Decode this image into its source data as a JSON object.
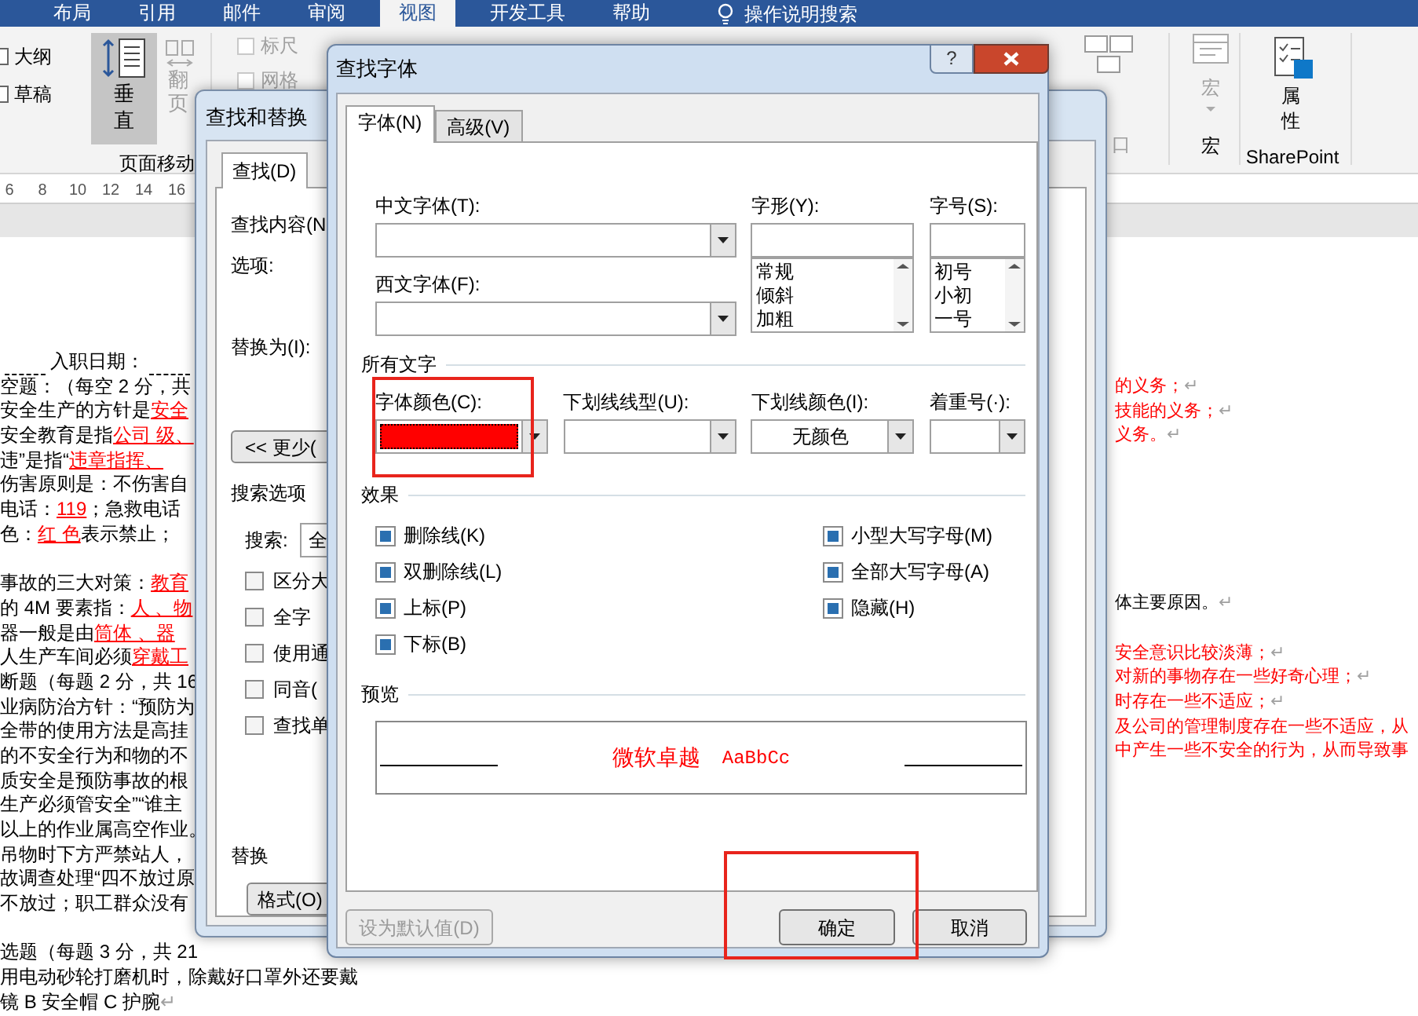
{
  "ribbon": {
    "tabs": [
      {
        "label": "布局",
        "selected": false
      },
      {
        "label": "引用",
        "selected": false
      },
      {
        "label": "邮件",
        "selected": false
      },
      {
        "label": "审阅",
        "selected": false
      },
      {
        "label": "视图",
        "selected": true
      },
      {
        "label": "开发工具",
        "selected": false
      },
      {
        "label": "帮助",
        "selected": false
      }
    ],
    "tell_me": "操作说明搜索",
    "views": [
      "大纲",
      "草稿"
    ],
    "vertical_button": {
      "label": "垂直",
      "selected": true
    },
    "page_button": {
      "label": "翻页",
      "disabled": true
    },
    "page_movement_label": "页面移动",
    "show_checks": [
      {
        "label": "标尺",
        "checked": false
      },
      {
        "label": "网格",
        "checked": false
      }
    ],
    "window_label": "口",
    "macro_button": {
      "label": "宏",
      "disabled": true
    },
    "macro_group": "宏",
    "properties_button": "属性",
    "sharepoint_group": "SharePoint"
  },
  "ruler": [
    "6",
    "8",
    "10",
    "12",
    "14",
    "16"
  ],
  "document_left": [
    [
      [
        {
          "kind": "blank"
        },
        {
          "kind": "plain",
          "text": "入职日期："
        },
        {
          "kind": "blank"
        }
      ],
      [
        {
          "kind": "plain",
          "text": "空题：（每空 2 分，共"
        }
      ],
      [
        {
          "kind": "plain",
          "text": "安全生产的方针是"
        },
        {
          "kind": "answer",
          "text": "安全"
        }
      ],
      [
        {
          "kind": "plain",
          "text": "安全教育是指"
        },
        {
          "kind": "answer",
          "text": "公司 级、"
        }
      ],
      [
        {
          "kind": "plain",
          "text": "违”是指“"
        },
        {
          "kind": "answer",
          "text": "违章指挥、"
        }
      ],
      [
        {
          "kind": "plain",
          "text": "伤害原则是：不伤害自"
        }
      ],
      [
        {
          "kind": "plain",
          "text": "电话："
        },
        {
          "kind": "answer",
          "text": "119"
        },
        {
          "kind": "plain",
          "text": "；急救电话"
        }
      ],
      [
        {
          "kind": "plain",
          "text": "色："
        },
        {
          "kind": "answer",
          "text": "红 色"
        },
        {
          "kind": "plain",
          "text": "表示禁止；"
        }
      ]
    ],
    [
      [
        {
          "kind": "plain",
          "text": "事故的三大对策："
        },
        {
          "kind": "answer",
          "text": "教育"
        }
      ],
      [
        {
          "kind": "plain",
          "text": "的 4M 要素指："
        },
        {
          "kind": "answer",
          "text": "人 、物"
        }
      ],
      [
        {
          "kind": "plain",
          "text": "器一般是由"
        },
        {
          "kind": "answer",
          "text": "筒体 、器"
        }
      ],
      [
        {
          "kind": "plain",
          "text": "人生产车间必须"
        },
        {
          "kind": "answer",
          "text": "穿戴工"
        }
      ],
      [
        {
          "kind": "plain",
          "text": "断题（每题 2 分，共 16"
        }
      ],
      [
        {
          "kind": "plain",
          "text": "业病防治方针：“预防为"
        }
      ],
      [
        {
          "kind": "plain",
          "text": "全带的使用方法是高挂"
        }
      ],
      [
        {
          "kind": "plain",
          "text": "的不安全行为和物的不"
        }
      ],
      [
        {
          "kind": "plain",
          "text": "质安全是预防事故的根"
        }
      ],
      [
        {
          "kind": "plain",
          "text": "生产必须管安全”“谁主"
        }
      ],
      [
        {
          "kind": "plain",
          "text": "以上的作业属高空作业。"
        }
      ],
      [
        {
          "kind": "plain",
          "text": "吊物时下方严禁站人，"
        }
      ],
      [
        {
          "kind": "plain",
          "text": "故调查处理“四不放过原"
        }
      ],
      [
        {
          "kind": "plain",
          "text": "不放过；职工群众没有"
        }
      ]
    ],
    [
      [
        {
          "kind": "plain",
          "text": "选题（每题 3 分，共 21"
        }
      ],
      [
        {
          "kind": "plain",
          "text": "用电动砂轮打磨机时，除戴好口罩外还要戴"
        }
      ],
      [
        {
          "kind": "plain",
          "text": "镜 B 安全帽 C 护腕"
        },
        {
          "kind": "mark",
          "text": "↵"
        }
      ]
    ]
  ],
  "document_right": [
    [
      [
        {
          "kind": "answer_text",
          "text": "的义务；"
        },
        {
          "kind": "mark",
          "text": "↵"
        }
      ],
      [
        {
          "kind": "answer_text",
          "text": "技能的义务；"
        },
        {
          "kind": "mark",
          "text": "↵"
        }
      ],
      [
        {
          "kind": "answer_text",
          "text": "义务。"
        },
        {
          "kind": "mark",
          "text": "↵"
        }
      ]
    ],
    [
      [
        {
          "kind": "plain",
          "text": "体主要原因。"
        },
        {
          "kind": "mark",
          "text": "↵"
        }
      ]
    ],
    [
      [
        {
          "kind": "answer_text",
          "text": "安全意识比较淡薄；"
        },
        {
          "kind": "mark",
          "text": "↵"
        }
      ],
      [
        {
          "kind": "answer_text",
          "text": "对新的事物存在一些好奇心理；"
        },
        {
          "kind": "mark",
          "text": "↵"
        }
      ],
      [
        {
          "kind": "answer_text",
          "text": "时存在一些不适应；"
        },
        {
          "kind": "mark",
          "text": "↵"
        }
      ],
      [
        {
          "kind": "answer_text",
          "text": "及公司的管理制度存在一些不适应，从"
        }
      ],
      [
        {
          "kind": "answer_text",
          "text": "中产生一些不安全的行为，从而导致事"
        }
      ]
    ]
  ],
  "find_replace": {
    "title": "查找和替换",
    "tab": "查找(D)",
    "find_label": "查找内容(N",
    "options_label": "选项:",
    "replace_label": "替换为(I):",
    "less_button": "<< 更少(",
    "search_options": "搜索选项",
    "search_label": "搜索:",
    "search_value": "全",
    "checks": [
      {
        "label": "区分大",
        "checked": false
      },
      {
        "label": "全字",
        "checked": false
      },
      {
        "label": "使用通",
        "checked": false
      },
      {
        "label": "同音(",
        "checked": false
      },
      {
        "label": "查找单",
        "checked": false
      }
    ],
    "replace_section": "替换",
    "format_button": "格式(O)"
  },
  "font_dialog": {
    "title": "查找字体",
    "help": "?",
    "tabs": [
      {
        "label": "字体(N)",
        "selected": true
      },
      {
        "label": "高级(V)",
        "selected": false
      }
    ],
    "chinese_font_label": "中文字体(T):",
    "western_font_label": "西文字体(F):",
    "style_label": "字形(Y):",
    "styles": [
      "常规",
      "倾斜",
      "加粗"
    ],
    "size_label": "字号(S):",
    "sizes": [
      "初号",
      "小初",
      "一号"
    ],
    "all_text": "所有文字",
    "font_color_label": "字体颜色(C):",
    "font_color": {
      "color": "#ff0000",
      "highlighted": true
    },
    "underline_style_label": "下划线线型(U):",
    "underline_color_label": "下划线颜色(I):",
    "underline_color": "无颜色",
    "emphasis_label": "着重号(·):",
    "effects": "效果",
    "effect_checks": [
      {
        "label": "删除线(K)",
        "indeterminate": true
      },
      {
        "label": "双删除线(L)",
        "indeterminate": true
      },
      {
        "label": "上标(P)",
        "indeterminate": true
      },
      {
        "label": "下标(B)",
        "indeterminate": true
      },
      {
        "label": "小型大写字母(M)",
        "indeterminate": true
      },
      {
        "label": "全部大写字母(A)",
        "indeterminate": true
      },
      {
        "label": "隐藏(H)",
        "indeterminate": true
      }
    ],
    "preview_label": "预览",
    "preview_cjk": "微软卓越",
    "preview_latin": "AaBbCc",
    "default_button": {
      "label": "设为默认值(D)",
      "disabled": true
    },
    "ok_button": {
      "label": "确定",
      "highlighted": true
    },
    "cancel_button": "取消"
  }
}
